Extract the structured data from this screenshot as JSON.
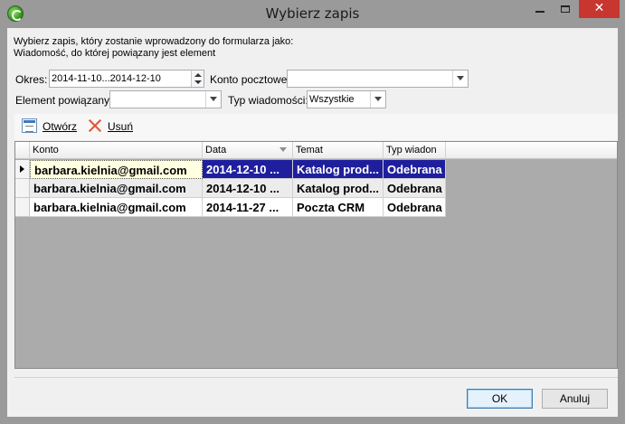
{
  "window": {
    "title": "Wybierz zapis",
    "close_glyph": "✕"
  },
  "instructions": {
    "line1": "Wybierz zapis, który zostanie wprowadzony do formularza jako:",
    "line2": "Wiadomość, do której powiązany jest element"
  },
  "filters": {
    "okres_label": "Okres:",
    "okres_value": "2014-11-10...2014-12-10",
    "konto_label": "Konto pocztowe:",
    "konto_value": "",
    "element_label": "Element powiązany:",
    "element_value": "",
    "typ_label": "Typ wiadomości:",
    "typ_value": "Wszystkie"
  },
  "toolbar": {
    "open_label": "Otwórz",
    "delete_label": "Usuń"
  },
  "grid": {
    "columns": [
      "Konto",
      "Data",
      "Temat",
      "Typ wiadon"
    ],
    "sorted_column": "Data",
    "rows": [
      {
        "konto": "barbara.kielnia@gmail.com",
        "data": "2014-12-10 ...",
        "temat": "Katalog prod...",
        "typ": "Odebrana"
      },
      {
        "konto": "barbara.kielnia@gmail.com",
        "data": "2014-12-10 ...",
        "temat": "Katalog prod...",
        "typ": "Odebrana"
      },
      {
        "konto": "barbara.kielnia@gmail.com",
        "data": "2014-11-27 ...",
        "temat": "Poczta  CRM",
        "typ": "Odebrana"
      }
    ],
    "selected_row": 0
  },
  "buttons": {
    "ok": "OK",
    "cancel": "Anuluj"
  },
  "colors": {
    "selection": "#1f1f9e",
    "close_button": "#c7372f",
    "delete_icon": "#e35335"
  }
}
